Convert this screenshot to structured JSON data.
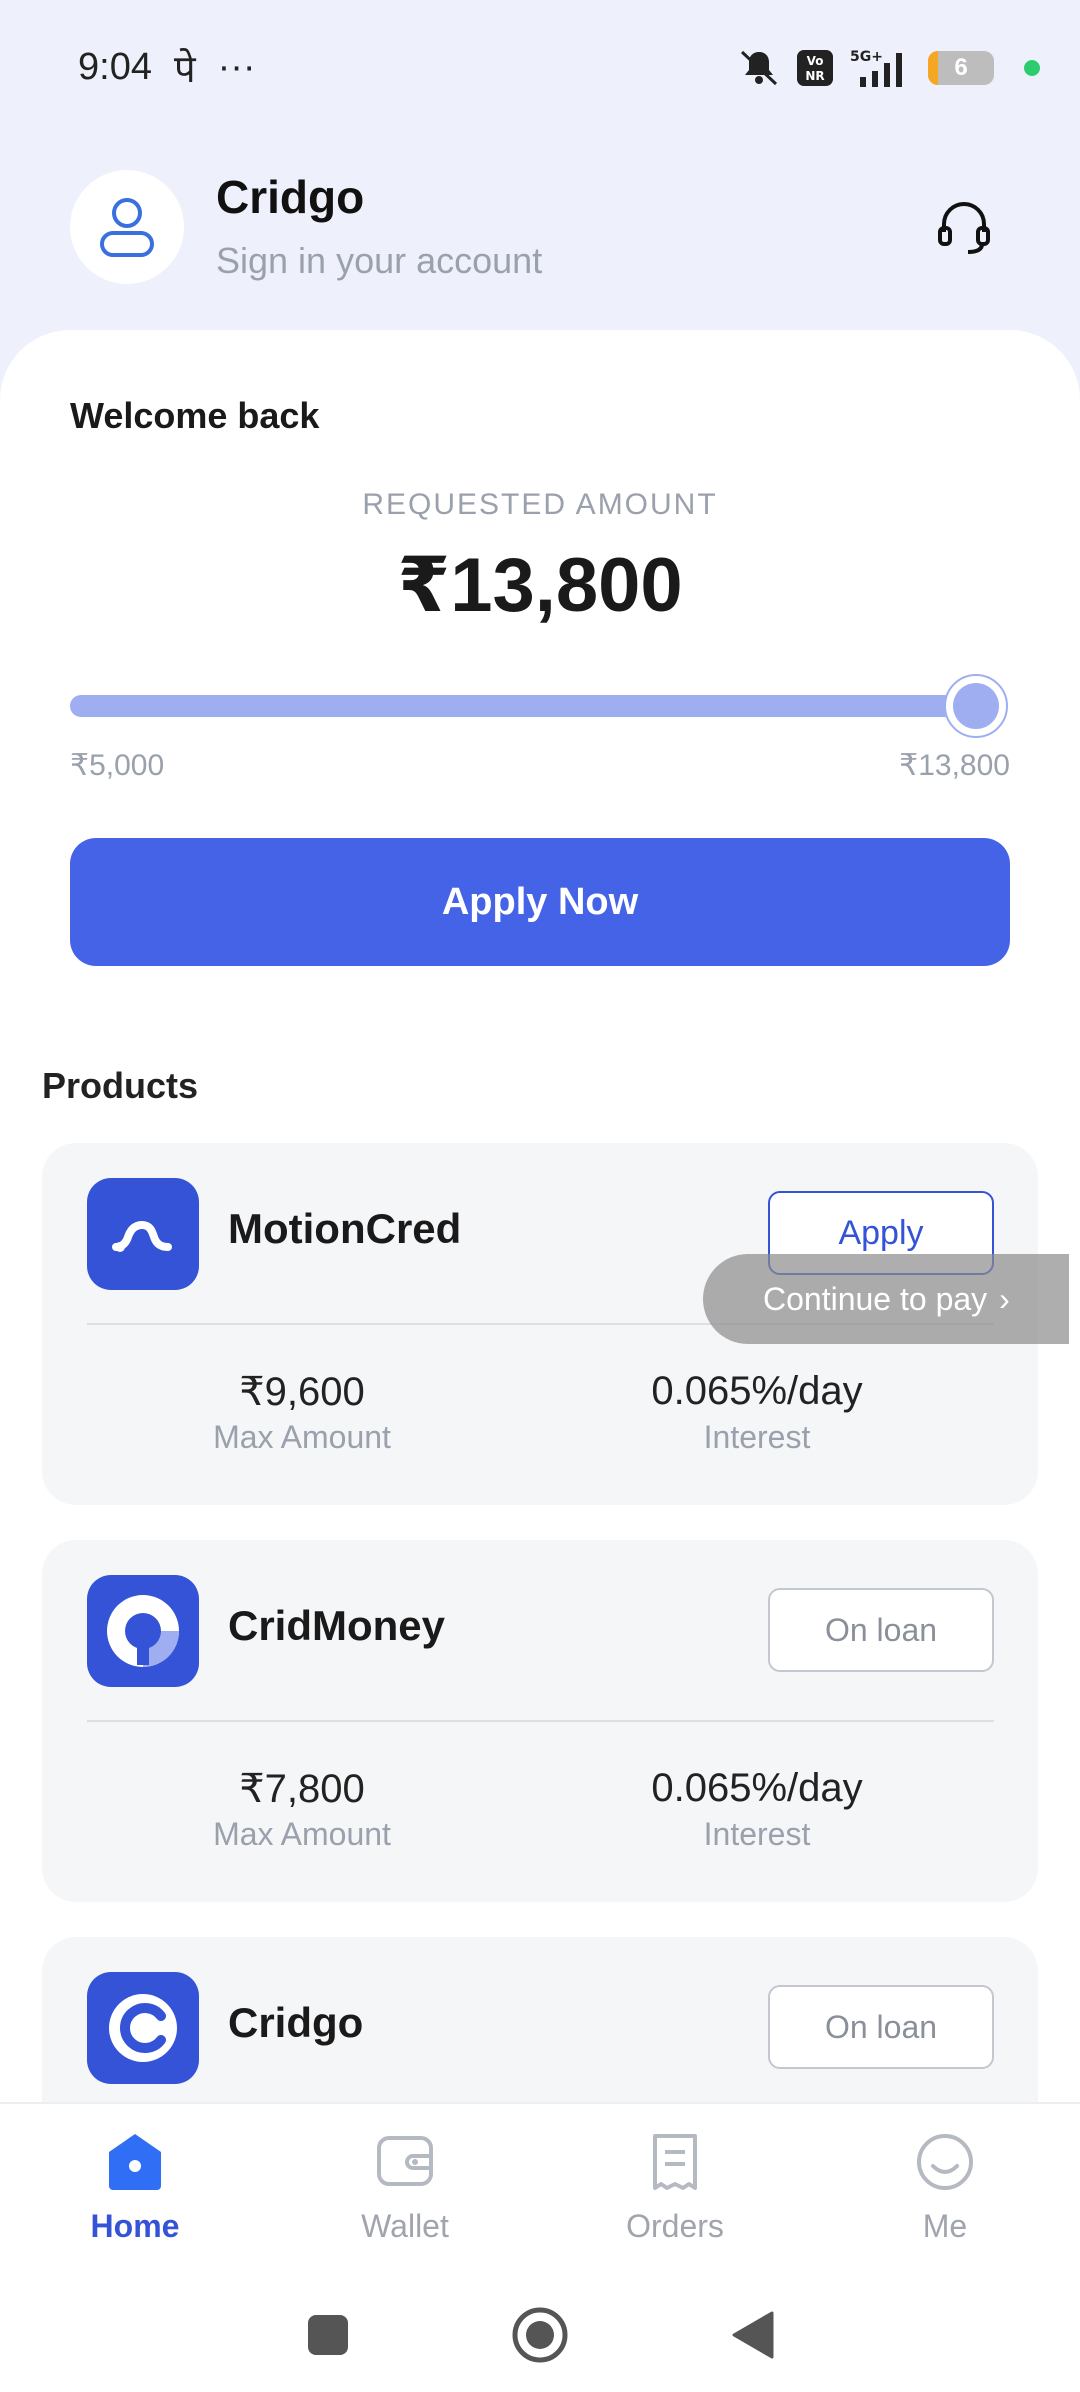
{
  "status_bar": {
    "time": "9:04",
    "carrier_glyph": "पे",
    "more": "···",
    "network": "5G+",
    "volte": "VoNR",
    "battery": "6",
    "icons": [
      "mute-icon",
      "volte-icon",
      "signal-icon",
      "battery-icon"
    ]
  },
  "header": {
    "app_name": "Cridgo",
    "subtitle": "Sign in your account",
    "icons": [
      "user-icon",
      "headset-icon"
    ]
  },
  "loan": {
    "welcome": "Welcome back",
    "requested_label": "REQUESTED AMOUNT",
    "requested_amount": "₹13,800",
    "slider_min": "₹5,000",
    "slider_max": "₹13,800",
    "slider_value": 1.0,
    "apply_label": "Apply Now"
  },
  "products": {
    "title": "Products",
    "items": [
      {
        "name": "MotionCred",
        "button": "Apply",
        "max_amount": "₹9,600",
        "max_label": "Max Amount",
        "interest": "0.065%/day",
        "interest_label": "Interest"
      },
      {
        "name": "CridMoney",
        "button": "On loan",
        "max_amount": "₹7,800",
        "max_label": "Max Amount",
        "interest": "0.065%/day",
        "interest_label": "Interest"
      },
      {
        "name": "Cridgo",
        "button": "On loan"
      }
    ]
  },
  "toast": {
    "label": "Continue to pay",
    "chevron": "›"
  },
  "bottom_nav": {
    "items": [
      {
        "label": "Home",
        "icon": "home-icon",
        "active": true
      },
      {
        "label": "Wallet",
        "icon": "wallet-icon",
        "active": false
      },
      {
        "label": "Orders",
        "icon": "orders-icon",
        "active": false
      },
      {
        "label": "Me",
        "icon": "smile-icon",
        "active": false
      }
    ]
  },
  "colors": {
    "primary": "#4563e6",
    "brand_dark": "#3453d6",
    "slider": "#9eaef0",
    "background": "#eef1fb",
    "card": "#f5f6f8"
  }
}
